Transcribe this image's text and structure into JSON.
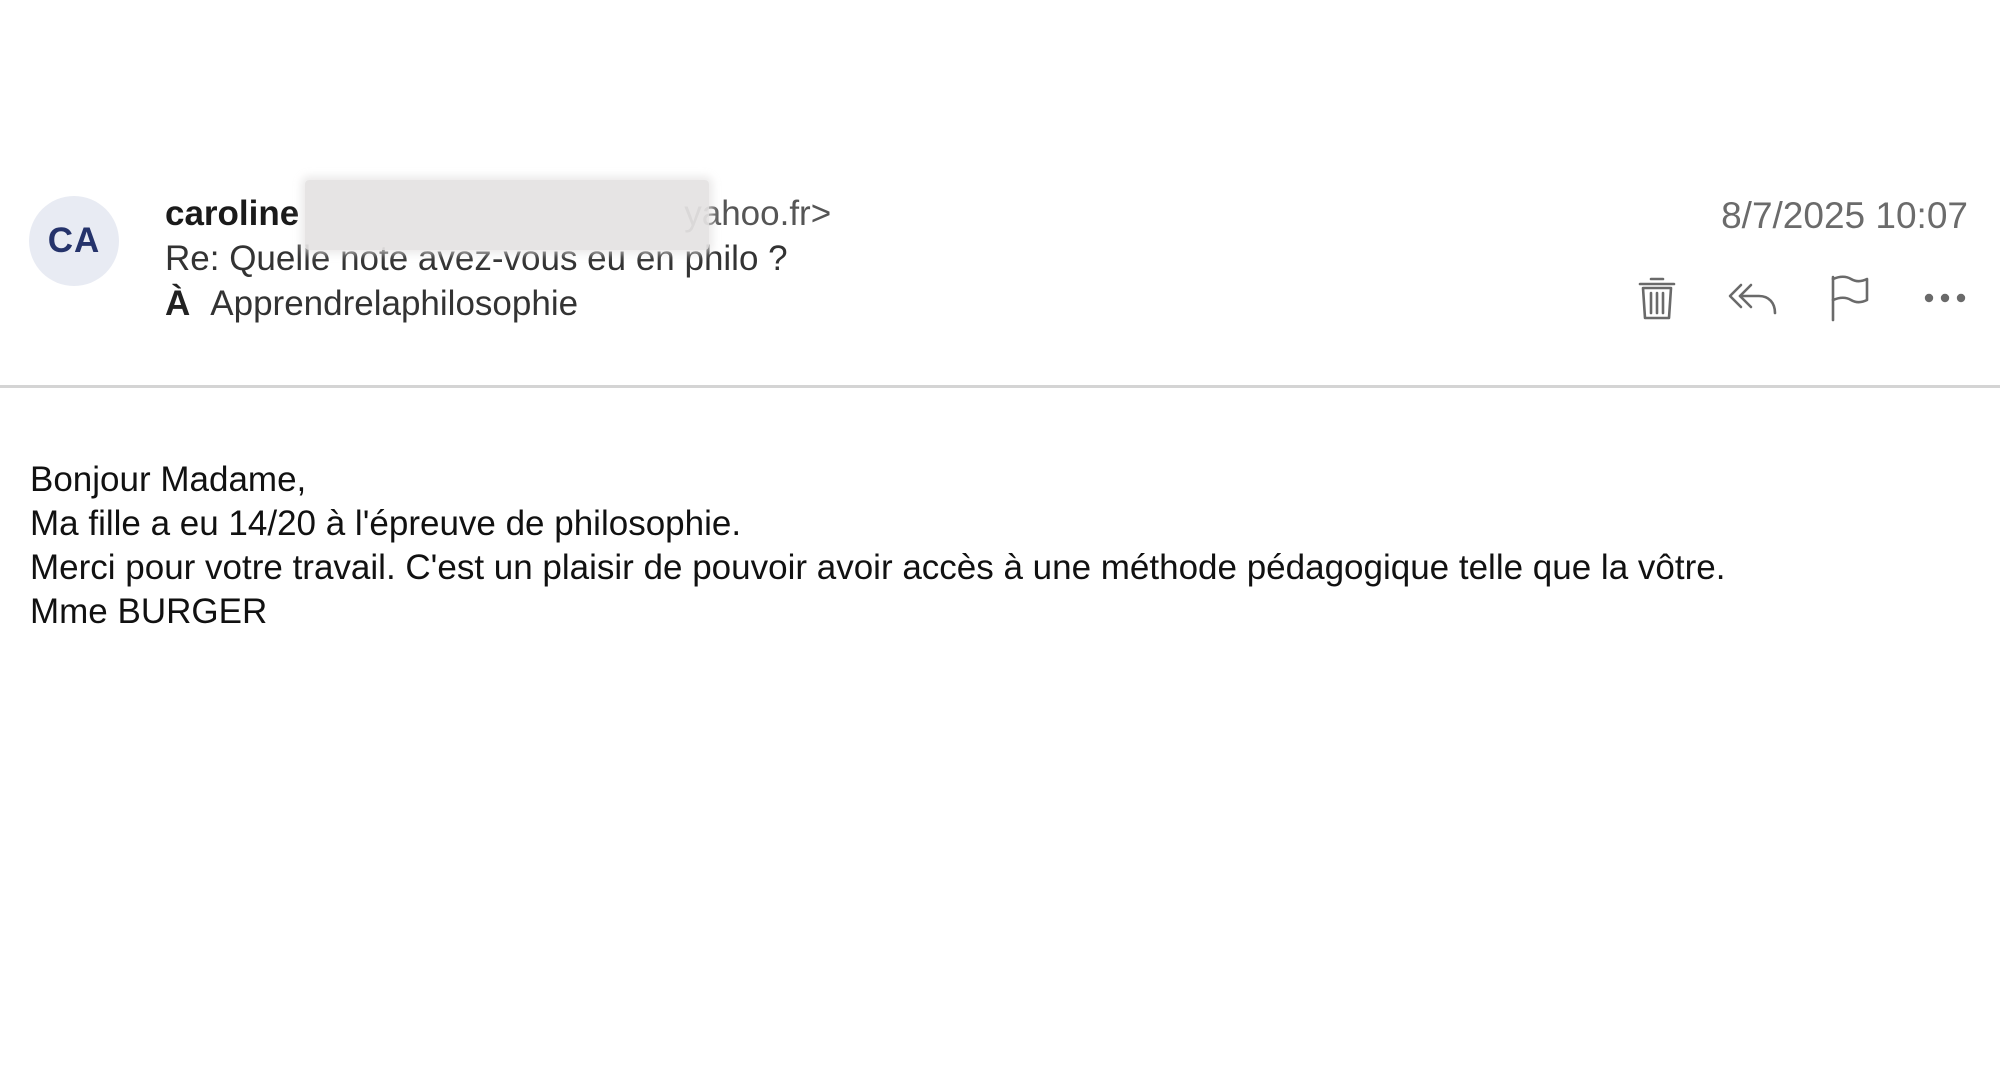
{
  "header": {
    "avatar_initials": "CA",
    "sender_name": "caroline",
    "sender_email_fragment": "yahoo.fr>",
    "subject": "Re: Quelle note avez-vous eu en philo ?",
    "recipient_prefix": "À",
    "recipient": "Apprendrelaphilosophie",
    "timestamp": "8/7/2025 10:07"
  },
  "actions": [
    {
      "name": "delete",
      "icon": "trash-icon"
    },
    {
      "name": "reply-all",
      "icon": "reply-all-icon"
    },
    {
      "name": "flag",
      "icon": "flag-icon"
    },
    {
      "name": "more",
      "icon": "more-horizontal-icon"
    }
  ],
  "body": {
    "lines": [
      "Bonjour Madame,",
      "Ma fille a eu 14/20 à l'épreuve de philosophie.",
      "Merci pour votre travail. C'est un plaisir de pouvoir avoir accès à une méthode pédagogique telle que la vôtre.",
      "Mme BURGER"
    ]
  },
  "colors": {
    "avatar_bg": "#e8ebf3",
    "avatar_text": "#25336b",
    "timestamp": "#6b6b6b",
    "divider": "#d4d4d4",
    "icon": "#6a6a6a"
  }
}
